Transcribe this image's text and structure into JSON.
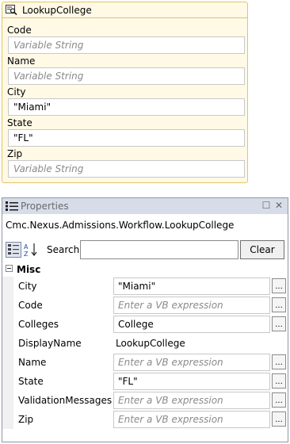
{
  "activity": {
    "title": "LookupCollege",
    "fields": [
      {
        "label": "Code",
        "value": "Variable String",
        "is_placeholder": true
      },
      {
        "label": "Name",
        "value": "Variable String",
        "is_placeholder": true
      },
      {
        "label": "City",
        "value": "\"Miami\"",
        "is_placeholder": false
      },
      {
        "label": "State",
        "value": "\"FL\"",
        "is_placeholder": false
      },
      {
        "label": "Zip",
        "value": "Variable String",
        "is_placeholder": true
      }
    ]
  },
  "properties": {
    "title": "Properties",
    "pin_glyph": "☐",
    "close_glyph": "✕",
    "object_path": "Cmc.Nexus.Admissions.Workflow.LookupCollege",
    "search_label": "Search:",
    "search_value": "",
    "clear_label": "Clear",
    "category": "Misc",
    "ellipsis_label": "...",
    "rows": [
      {
        "name": "City",
        "value": "\"Miami\"",
        "is_placeholder": false,
        "has_box": true,
        "has_ellipsis": true
      },
      {
        "name": "Code",
        "value": "Enter a VB expression",
        "is_placeholder": true,
        "has_box": true,
        "has_ellipsis": true
      },
      {
        "name": "Colleges",
        "value": "College",
        "is_placeholder": false,
        "has_box": true,
        "has_ellipsis": true
      },
      {
        "name": "DisplayName",
        "value": "LookupCollege",
        "is_placeholder": false,
        "has_box": false,
        "has_ellipsis": false
      },
      {
        "name": "Name",
        "value": "Enter a VB expression",
        "is_placeholder": true,
        "has_box": true,
        "has_ellipsis": true
      },
      {
        "name": "State",
        "value": "\"FL\"",
        "is_placeholder": false,
        "has_box": true,
        "has_ellipsis": true
      },
      {
        "name": "ValidationMessages",
        "value": "Enter a VB expression",
        "is_placeholder": true,
        "has_box": true,
        "has_ellipsis": true
      },
      {
        "name": "Zip",
        "value": "Enter a VB expression",
        "is_placeholder": true,
        "has_box": true,
        "has_ellipsis": true
      }
    ]
  },
  "colors": {
    "activity_border": "#e5c365",
    "activity_bg": "#fff9e6",
    "titlebar_bg": "#d7dde8",
    "placeholder_text": "#8a8a8a"
  },
  "icons": {
    "activity": "lookup-activity-icon",
    "properties": "properties-list-icon",
    "categorize": "categorized-view-icon",
    "alphabetical": "alphabetical-sort-icon"
  }
}
